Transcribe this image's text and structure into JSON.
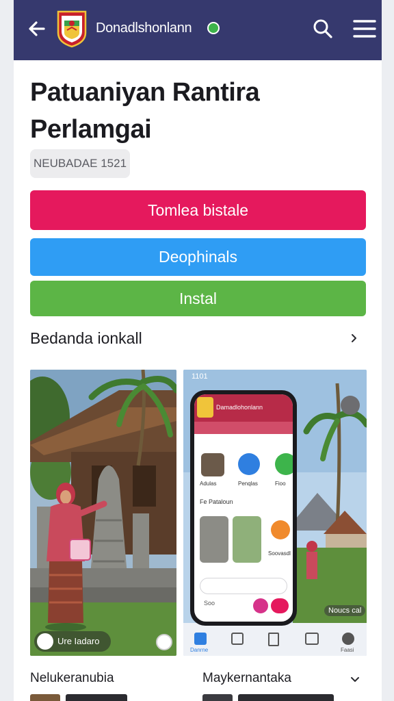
{
  "app_bar": {
    "app_name": "Donadlshonlann",
    "back_icon": "arrow-left-icon",
    "search_icon": "search-icon",
    "menu_icon": "hamburger-menu-icon",
    "color": "#36396e"
  },
  "title": "Patuaniyan Rantira Perlamgai",
  "badge": "NEUBADAE 1521",
  "buttons": {
    "primary": "Tomlea bistale",
    "secondary": "Deophinals",
    "install": "Instal"
  },
  "colors": {
    "primary": "#e5195d",
    "secondary": "#2f9df4",
    "install": "#5cb546"
  },
  "section": {
    "title": "Bedanda ionkall",
    "chevron_icon": "chevron-right-icon"
  },
  "screenshots": [
    {
      "caption": "Ure Iadaro",
      "caption_icon": "heart-icon",
      "corner_icon": "share-icon"
    },
    {
      "status_time": "1101",
      "phone_header": "Damadlohonlann",
      "shortcuts": [
        "Adulas",
        "Penqlas",
        "Fioo"
      ],
      "feature_title": "Fe Pataloun",
      "tile_label": "Soovasdl",
      "search_text": "Soo",
      "tabs": [
        "Danrne",
        "",
        "",
        "",
        "Faasi"
      ],
      "overlay_label": "Noucs cal"
    }
  ],
  "bottom": {
    "left_label": "Nelukeranubia",
    "right_label": "Maykernantaka",
    "right_chevron_icon": "chevron-down-icon"
  }
}
